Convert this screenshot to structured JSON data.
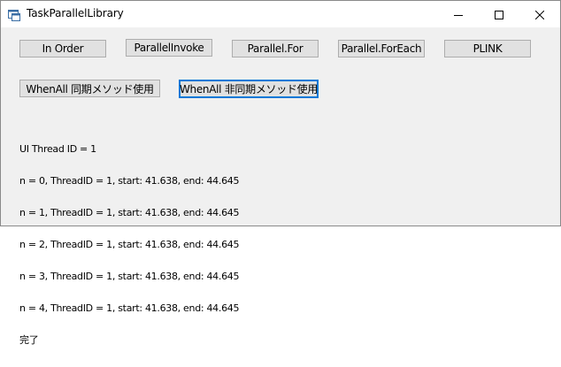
{
  "window": {
    "title": "TaskParallelLibrary"
  },
  "buttons_row1": [
    {
      "label": "In Order"
    },
    {
      "label": "ParallelInvoke"
    },
    {
      "label": "Parallel.For"
    },
    {
      "label": "Parallel.ForEach"
    },
    {
      "label": "PLINK"
    }
  ],
  "buttons_row2": [
    {
      "label": "WhenAll 同期メソッド使用"
    },
    {
      "label": "WhenAll 非同期メソッド使用"
    }
  ],
  "output_lines": [
    "UI Thread ID = 1",
    "n = 0, ThreadID = 1, start: 41.638, end: 44.645",
    "n = 1, ThreadID = 1, start: 41.638, end: 44.645",
    "n = 2, ThreadID = 1, start: 41.638, end: 44.645",
    "n = 3, ThreadID = 1, start: 41.638, end: 44.645",
    "n = 4, ThreadID = 1, start: 41.638, end: 44.645",
    "完了"
  ],
  "icons": {
    "app": "app-window-icon",
    "minimize": "minimize-icon",
    "maximize": "maximize-icon",
    "close": "close-icon"
  },
  "colors": {
    "focus_border": "#0078d7",
    "button_face": "#e1e1e1",
    "form_background": "#f0f0f0"
  }
}
